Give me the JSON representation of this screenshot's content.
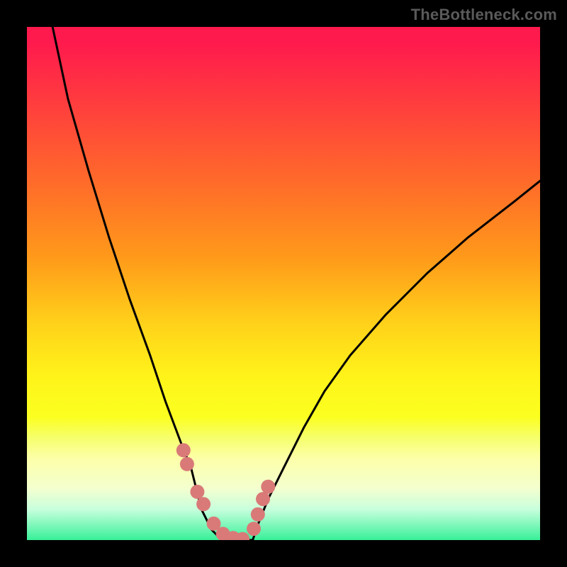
{
  "watermark": "TheBottleneck.com",
  "chart_data": {
    "type": "line",
    "title": "",
    "xlabel": "",
    "ylabel": "",
    "xlim": [
      0,
      100
    ],
    "ylim": [
      0,
      100
    ],
    "left_curve": {
      "x": [
        5,
        8,
        12,
        16,
        20,
        24,
        27,
        30,
        32,
        33,
        34,
        36,
        38,
        40,
        42
      ],
      "y": [
        100,
        86,
        72,
        59,
        47,
        36,
        27,
        19,
        14,
        10,
        6,
        2,
        0,
        0,
        0
      ]
    },
    "right_curve": {
      "x": [
        42,
        44,
        45,
        47,
        50,
        54,
        58,
        63,
        70,
        78,
        86,
        95,
        100
      ],
      "y": [
        0,
        0,
        3,
        8,
        14,
        22,
        29,
        36,
        44,
        52,
        59,
        66,
        70
      ]
    },
    "markers_left": {
      "x": [
        30.5,
        31.2,
        33.2,
        34.4,
        36.4,
        38.2,
        40.2,
        42.0
      ],
      "y": [
        17.5,
        14.8,
        9.4,
        7.0,
        3.2,
        1.2,
        0.4,
        0.2
      ]
    },
    "markers_right": {
      "x": [
        44.2,
        45.0,
        46.0,
        47.0
      ],
      "y": [
        2.2,
        5.0,
        8.0,
        10.4
      ]
    },
    "gradient_stops": [
      {
        "pos": 0,
        "color": "#ff1a4d"
      },
      {
        "pos": 30,
        "color": "#ff6a2a"
      },
      {
        "pos": 58,
        "color": "#ffd21a"
      },
      {
        "pos": 80,
        "color": "#f6ff6a"
      },
      {
        "pos": 100,
        "color": "#38f099"
      }
    ],
    "marker_color": "#d97a78",
    "marker_radius_px": 10
  }
}
